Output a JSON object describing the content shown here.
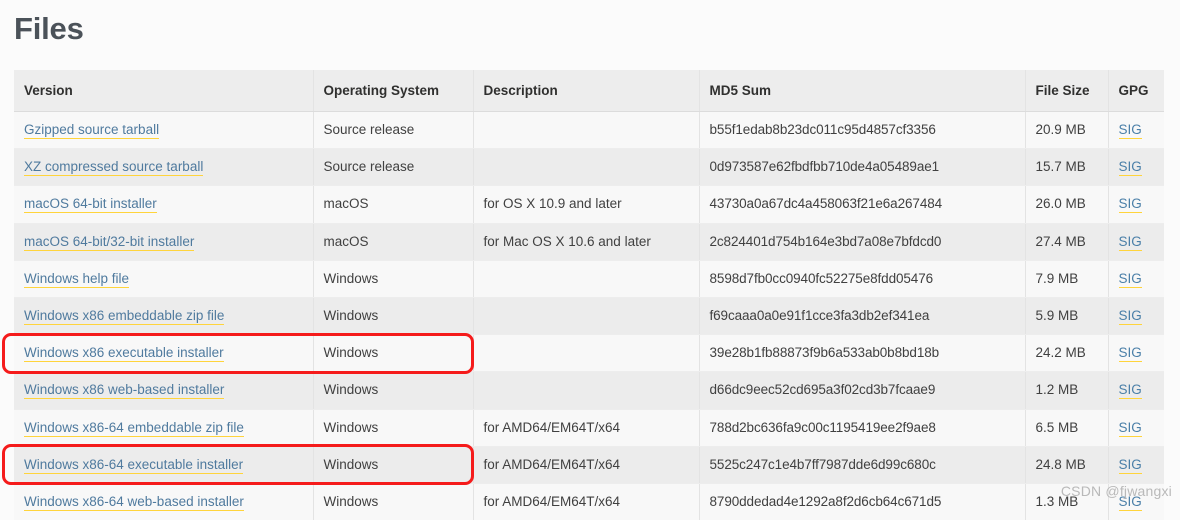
{
  "page": {
    "title": "Files",
    "watermark": "CSDN @fjwangxi"
  },
  "table": {
    "columns": [
      {
        "key": "version",
        "label": "Version"
      },
      {
        "key": "os",
        "label": "Operating System"
      },
      {
        "key": "description",
        "label": "Description"
      },
      {
        "key": "md5",
        "label": "MD5 Sum"
      },
      {
        "key": "filesize",
        "label": "File Size"
      },
      {
        "key": "gpg",
        "label": "GPG"
      }
    ],
    "gpg_link_label": "SIG",
    "rows": [
      {
        "version": "Gzipped source tarball",
        "os": "Source release",
        "description": "",
        "md5": "b55f1edab8b23dc011c95d4857cf3356",
        "filesize": "20.9 MB",
        "gpg": "SIG",
        "highlighted": false
      },
      {
        "version": "XZ compressed source tarball",
        "os": "Source release",
        "description": "",
        "md5": "0d973587e62fbdfbb710de4a05489ae1",
        "filesize": "15.7 MB",
        "gpg": "SIG",
        "highlighted": false
      },
      {
        "version": "macOS 64-bit installer",
        "os": "macOS",
        "description": "for OS X 10.9 and later",
        "md5": "43730a0a67dc4a458063f21e6a267484",
        "filesize": "26.0 MB",
        "gpg": "SIG",
        "highlighted": false
      },
      {
        "version": "macOS 64-bit/32-bit installer",
        "os": "macOS",
        "description": "for Mac OS X 10.6 and later",
        "md5": "2c824401d754b164e3bd7a08e7bfdcd0",
        "filesize": "27.4 MB",
        "gpg": "SIG",
        "highlighted": false
      },
      {
        "version": "Windows help file",
        "os": "Windows",
        "description": "",
        "md5": "8598d7fb0cc0940fc52275e8fdd05476",
        "filesize": "7.9 MB",
        "gpg": "SIG",
        "highlighted": false
      },
      {
        "version": "Windows x86 embeddable zip file",
        "os": "Windows",
        "description": "",
        "md5": "f69caaa0a0e91f1cce3fa3db2ef341ea",
        "filesize": "5.9 MB",
        "gpg": "SIG",
        "highlighted": false
      },
      {
        "version": "Windows x86 executable installer",
        "os": "Windows",
        "description": "",
        "md5": "39e28b1fb88873f9b6a533ab0b8bd18b",
        "filesize": "24.2 MB",
        "gpg": "SIG",
        "highlighted": true
      },
      {
        "version": "Windows x86 web-based installer",
        "os": "Windows",
        "description": "",
        "md5": "d66dc9eec52cd695a3f02cd3b7fcaae9",
        "filesize": "1.2 MB",
        "gpg": "SIG",
        "highlighted": false
      },
      {
        "version": "Windows x86-64 embeddable zip file",
        "os": "Windows",
        "description": "for AMD64/EM64T/x64",
        "md5": "788d2bc636fa9c00c1195419ee2f9ae8",
        "filesize": "6.5 MB",
        "gpg": "SIG",
        "highlighted": false
      },
      {
        "version": "Windows x86-64 executable installer",
        "os": "Windows",
        "description": "for AMD64/EM64T/x64",
        "md5": "5525c247c1e4b7ff7987dde6d99c680c",
        "filesize": "24.8 MB",
        "gpg": "SIG",
        "highlighted": true
      },
      {
        "version": "Windows x86-64 web-based installer",
        "os": "Windows",
        "description": "for AMD64/EM64T/x64",
        "md5": "8790ddedad4e1292a8f2d6cb64c671d5",
        "filesize": "1.3 MB",
        "gpg": "SIG",
        "highlighted": false
      }
    ]
  },
  "annotations": {
    "color": "#f51b1b",
    "boxes": [
      {
        "target_row_index": 6,
        "label": "highlight-windows-x86-executable-installer"
      },
      {
        "target_row_index": 9,
        "label": "highlight-windows-x86-64-executable-installer"
      }
    ]
  }
}
